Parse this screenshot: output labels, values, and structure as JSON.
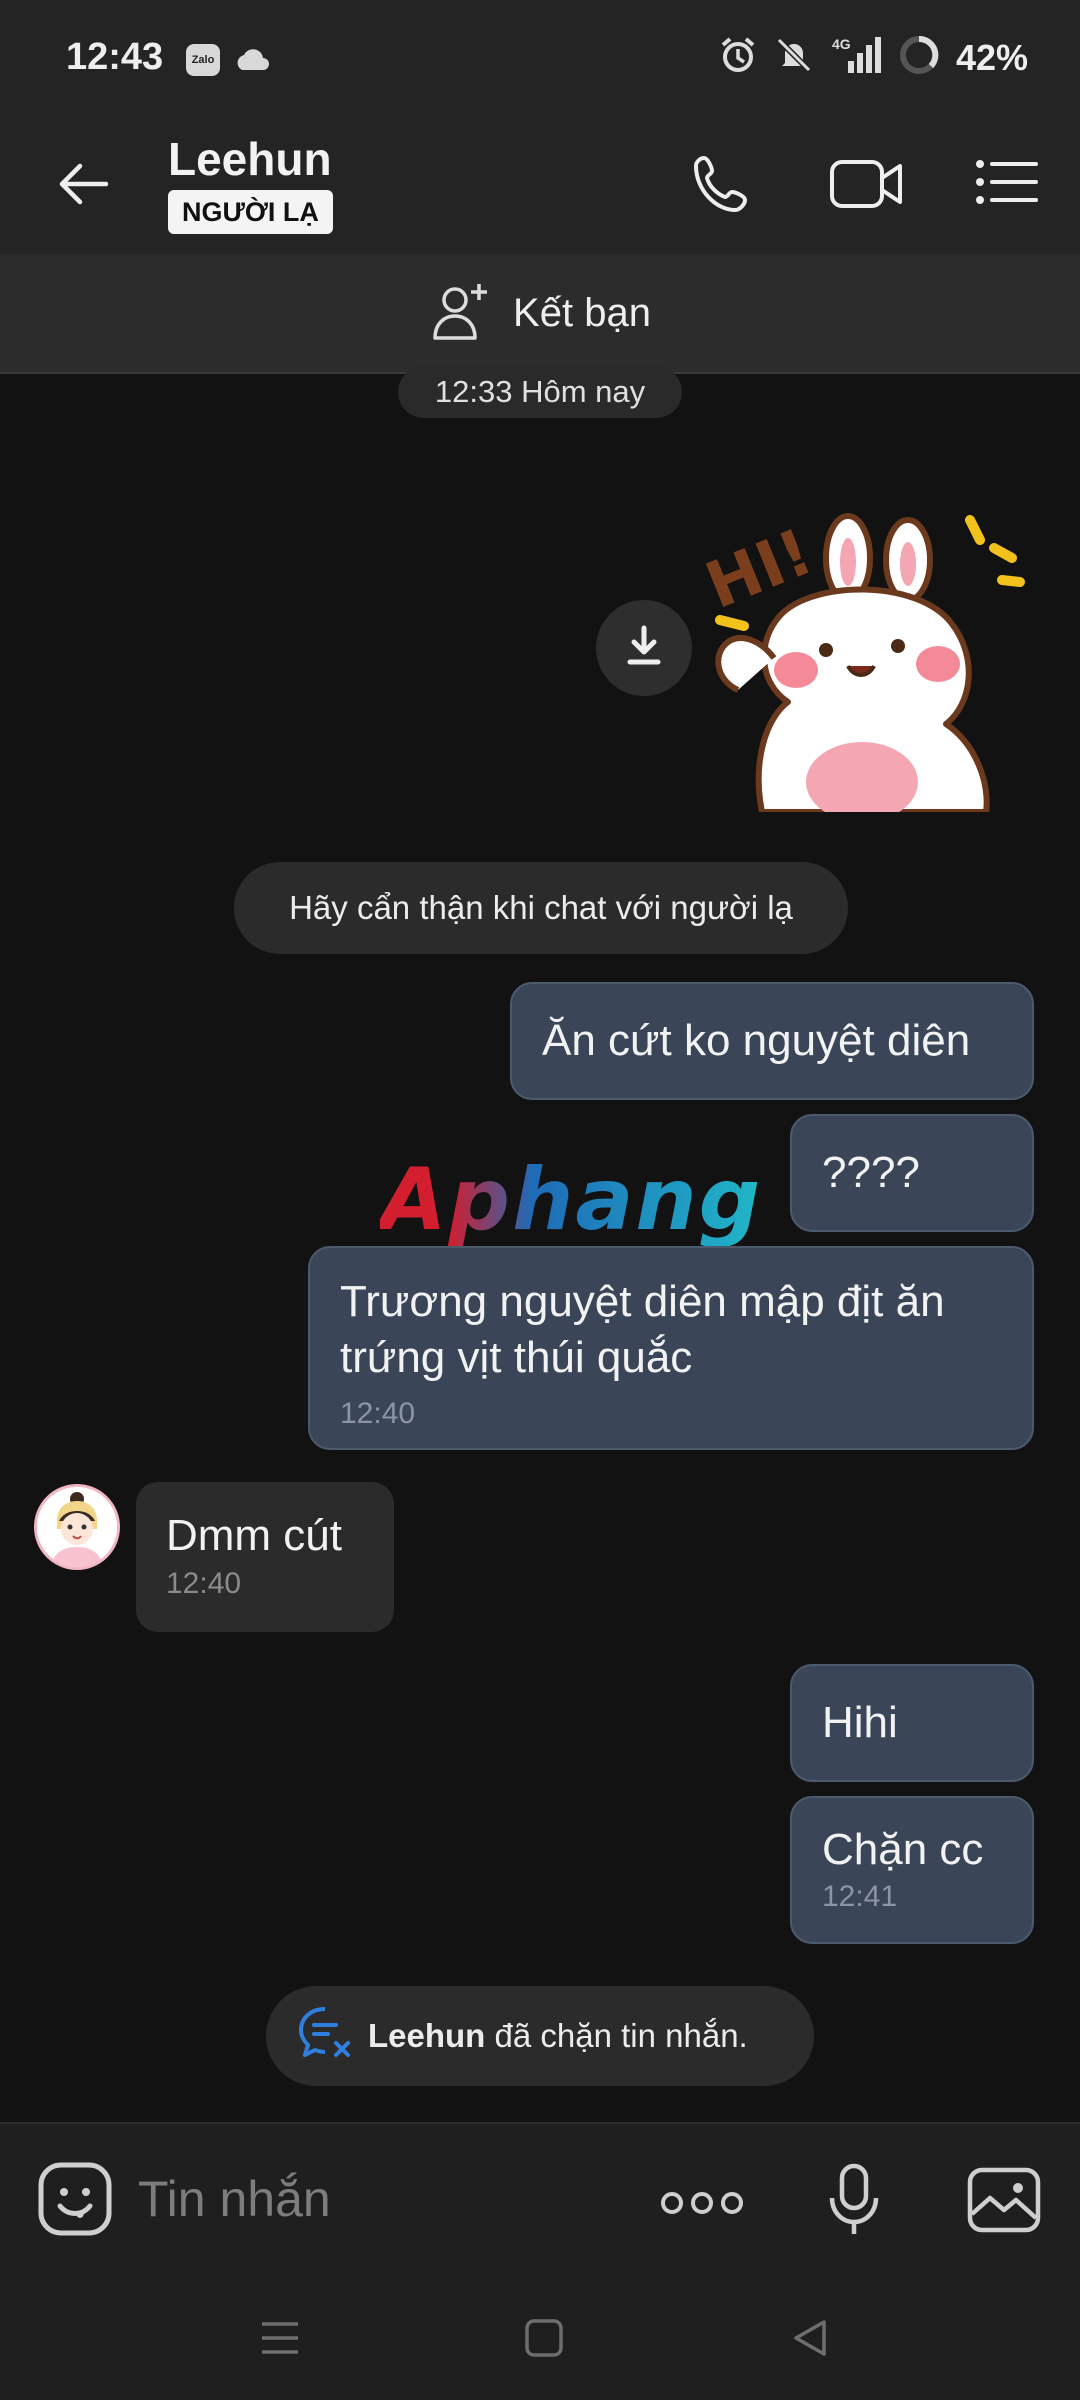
{
  "status_bar": {
    "time": "12:43",
    "zalo_label": "Zalo",
    "network": "4G",
    "battery": "42%",
    "icons": [
      "zalo-icon",
      "cloud-icon",
      "alarm-icon",
      "mute-icon",
      "signal-icon",
      "battery-icon"
    ]
  },
  "header": {
    "contact_name": "Leehun",
    "badge": "NGƯỜI LẠ",
    "icons": [
      "back-arrow-icon",
      "phone-icon",
      "video-camera-icon",
      "menu-list-icon"
    ]
  },
  "add_friend": {
    "label": "Kết bạn"
  },
  "chat": {
    "date_label": "12:33 Hôm nay",
    "notice": "Hãy cẩn thận khi chat với người lạ",
    "watermark": "Aphang",
    "messages": [
      {
        "direction": "sent",
        "text": "Ăn cứt ko nguyệt diên"
      },
      {
        "direction": "sent",
        "text": "????"
      },
      {
        "direction": "sent",
        "text": "Trương nguyệt diên mập địt ăn trứng vịt thúi quắc",
        "time": "12:40"
      },
      {
        "direction": "received",
        "text": "Dmm cút",
        "time": "12:40"
      },
      {
        "direction": "sent",
        "text": "Hihi"
      },
      {
        "direction": "sent",
        "text": "Chặn cc",
        "time": "12:41"
      }
    ],
    "blocked": {
      "name": "Leehun",
      "text": " đã chặn tin nhắn."
    }
  },
  "input": {
    "placeholder": "Tin nhắn"
  },
  "colors": {
    "background": "#121212",
    "bar": "#242424",
    "sent_bubble": "#3a4658",
    "received_bubble": "#2b2b2b",
    "blocked_icon": "#2f7fe0"
  }
}
